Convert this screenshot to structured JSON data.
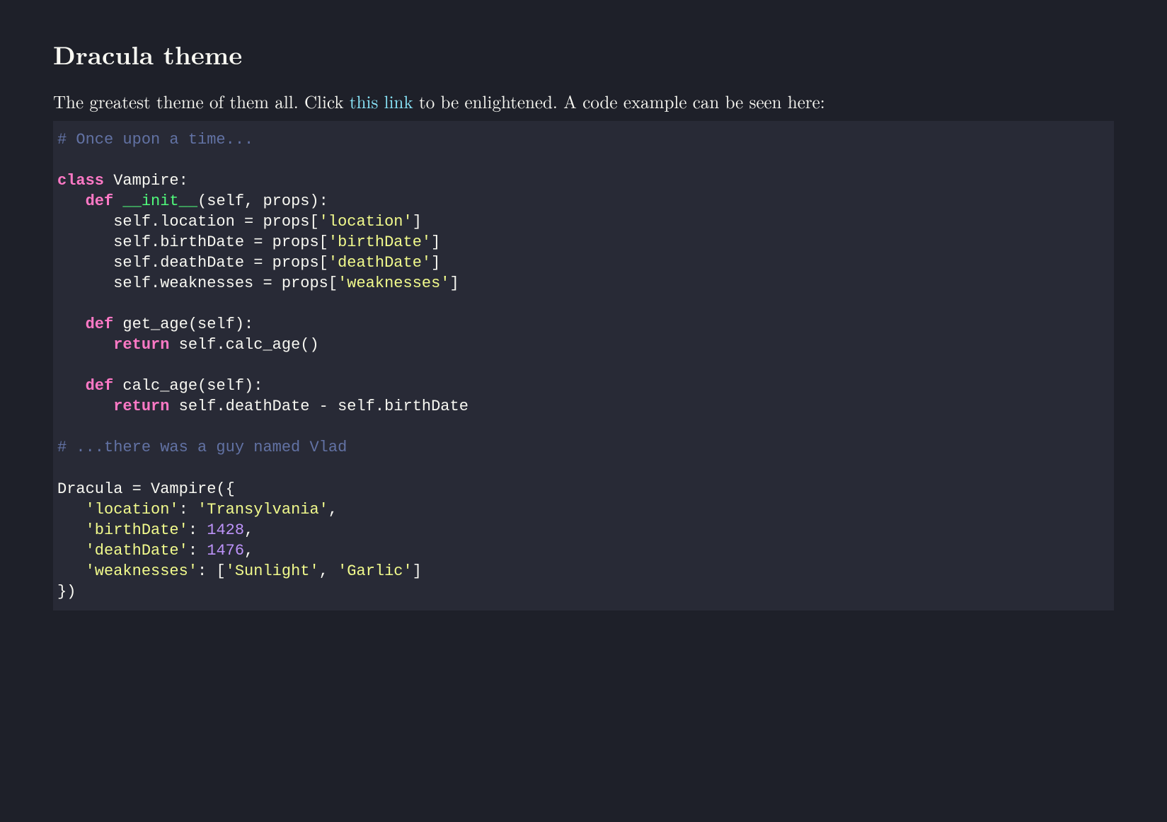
{
  "title": "Dracula theme",
  "intro_before": "The greatest theme of them all. Click ",
  "intro_link": "this link",
  "intro_after": " to be enlightened. A code example can be seen here:",
  "code": {
    "comment1": "# Once upon a time...",
    "kw_class": "class",
    "class_name": " Vampire:",
    "kw_def1": "def",
    "fn_init": "__init__",
    "init_params": "(self, props):",
    "assign_loc_a": "      self.location = props[",
    "str_location": "'location'",
    "assign_loc_b": "]",
    "assign_bd_a": "      self.birthDate = props[",
    "str_birthDate": "'birthDate'",
    "assign_bd_b": "]",
    "assign_dd_a": "      self.deathDate = props[",
    "str_deathDate": "'deathDate'",
    "assign_dd_b": "]",
    "assign_wk_a": "      self.weaknesses = props[",
    "str_weaknesses": "'weaknesses'",
    "assign_wk_b": "]",
    "kw_def2": "def",
    "fn_getage": " get_age(self):",
    "kw_return1": "return",
    "ret1_rest": " self.calc_age()",
    "kw_def3": "def",
    "fn_calcage": " calc_age(self):",
    "kw_return2": "return",
    "ret2_rest": " self.deathDate - self.birthDate",
    "comment2": "# ...there was a guy named Vlad",
    "instantiate": "Dracula = Vampire({",
    "dict_loc_key": "'location'",
    "dict_loc_sep": ": ",
    "dict_loc_val": "'Transylvania'",
    "dict_loc_end": ",",
    "dict_bd_key": "'birthDate'",
    "dict_bd_sep": ": ",
    "dict_bd_val": "1428",
    "dict_bd_end": ",",
    "dict_dd_key": "'deathDate'",
    "dict_dd_sep": ": ",
    "dict_dd_val": "1476",
    "dict_dd_end": ",",
    "dict_wk_key": "'weaknesses'",
    "dict_wk_sep": ": [",
    "dict_wk_v1": "'Sunlight'",
    "dict_wk_mid": ", ",
    "dict_wk_v2": "'Garlic'",
    "dict_wk_end": "]",
    "close": "})"
  }
}
